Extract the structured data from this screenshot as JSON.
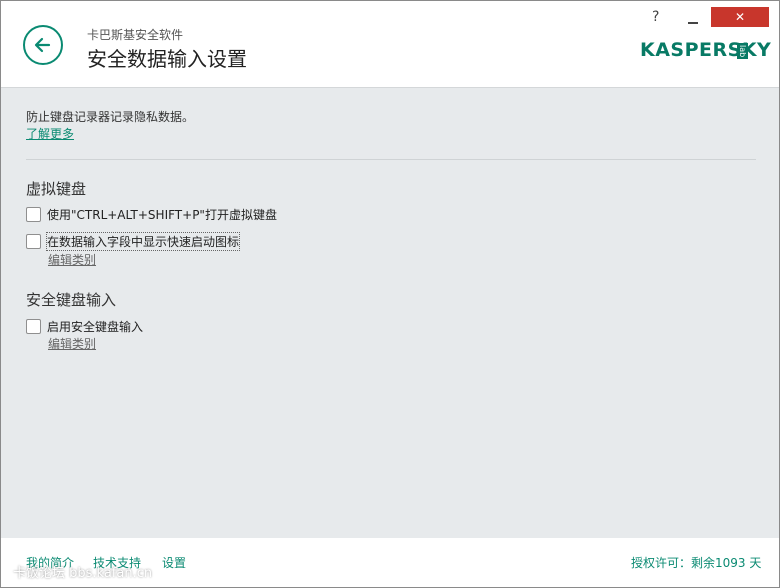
{
  "header": {
    "app_name": "卡巴斯基安全软件",
    "page_title": "安全数据输入设置",
    "help": "?",
    "close": "✕",
    "logo": "KASPERSKY",
    "logo_lab": "lab"
  },
  "content": {
    "description": "防止键盘记录器记录隐私数据。",
    "learn_more": "了解更多",
    "virtual_keyboard": {
      "title": "虚拟键盘",
      "option1": "使用\"CTRL+ALT+SHIFT+P\"打开虚拟键盘",
      "option2": "在数据输入字段中显示快速启动图标",
      "edit_categories": "编辑类别"
    },
    "secure_input": {
      "title": "安全键盘输入",
      "option1": "启用安全键盘输入",
      "edit_categories": "编辑类别"
    }
  },
  "footer": {
    "my_profile": "我的简介",
    "tech_support": "技术支持",
    "settings": "设置",
    "license": "授权许可：剩余1093 天",
    "watermark": "卡饭论坛 bbs.kafan.cn"
  },
  "colors": {
    "accent": "#0a8a72",
    "close": "#c8362c",
    "content_bg": "#e7eaec"
  }
}
